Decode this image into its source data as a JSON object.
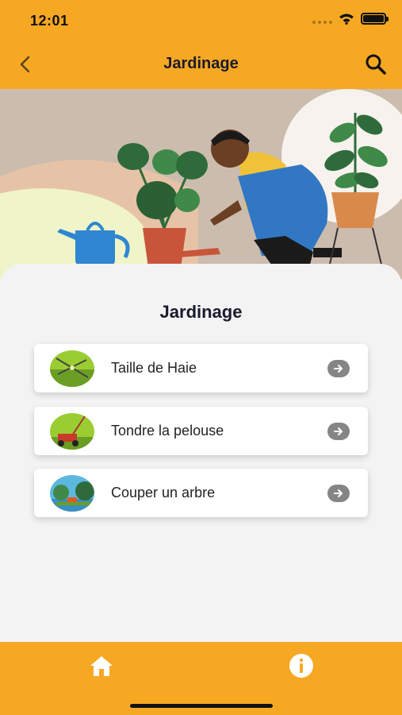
{
  "status": {
    "time": "12:01"
  },
  "nav": {
    "title": "Jardinage"
  },
  "main": {
    "section_title": "Jardinage",
    "items": [
      {
        "label": "Taille de Haie",
        "icon": "hedge-trimming-icon"
      },
      {
        "label": "Tondre la pelouse",
        "icon": "lawn-mower-icon"
      },
      {
        "label": "Couper un arbre",
        "icon": "tree-cutting-icon"
      }
    ]
  },
  "tabs": [
    {
      "icon": "home-icon"
    },
    {
      "icon": "info-icon"
    }
  ],
  "colors": {
    "accent": "#f6a823",
    "background": "#f3f3f3",
    "title": "#1a1a2e",
    "arrow": "#858585"
  }
}
